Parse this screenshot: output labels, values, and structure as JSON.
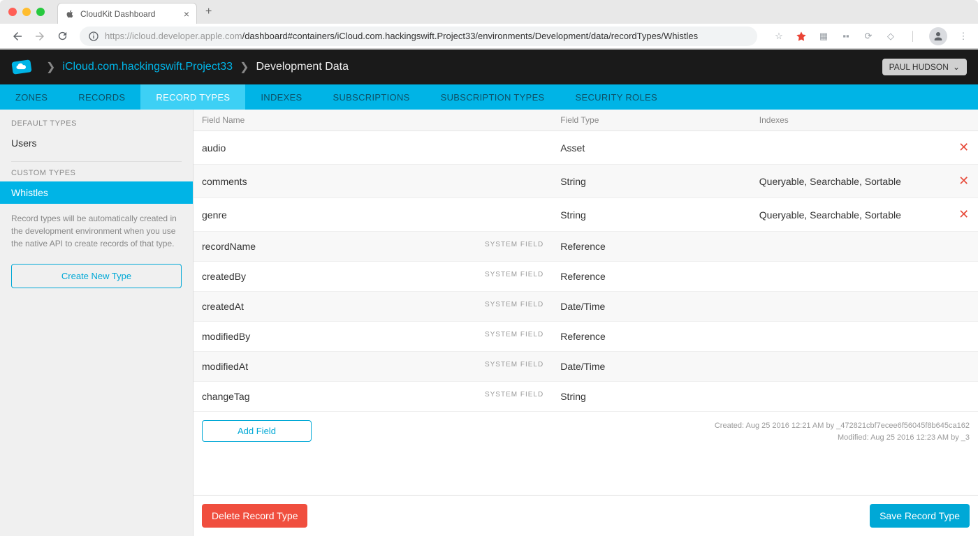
{
  "browser": {
    "tab_title": "CloudKit Dashboard",
    "url_host": "https://icloud.developer.apple.com",
    "url_path": "/dashboard#containers/iCloud.com.hackingswift.Project33/environments/Development/data/recordTypes/Whistles"
  },
  "header": {
    "breadcrumb_link": "iCloud.com.hackingswift.Project33",
    "breadcrumb_current": "Development Data",
    "user_name": "PAUL HUDSON"
  },
  "nav_tabs": [
    "ZONES",
    "RECORDS",
    "RECORD TYPES",
    "INDEXES",
    "SUBSCRIPTIONS",
    "SUBSCRIPTION TYPES",
    "SECURITY ROLES"
  ],
  "nav_tabs_active_index": 2,
  "sidebar": {
    "default_header": "DEFAULT TYPES",
    "default_items": [
      "Users"
    ],
    "custom_header": "CUSTOM TYPES",
    "custom_items": [
      "Whistles"
    ],
    "custom_selected_index": 0,
    "help_text": "Record types will be automatically created in the development environment when you use the native API to create records of that type.",
    "create_button": "Create New Type"
  },
  "table": {
    "columns": [
      "Field Name",
      "Field Type",
      "Indexes"
    ],
    "rows": [
      {
        "name": "audio",
        "type": "Asset",
        "indexes": "",
        "system": false,
        "deletable": true
      },
      {
        "name": "comments",
        "type": "String",
        "indexes": "Queryable, Searchable, Sortable",
        "system": false,
        "deletable": true
      },
      {
        "name": "genre",
        "type": "String",
        "indexes": "Queryable, Searchable, Sortable",
        "system": false,
        "deletable": true
      },
      {
        "name": "recordName",
        "type": "Reference",
        "indexes": "",
        "system": true,
        "deletable": false
      },
      {
        "name": "createdBy",
        "type": "Reference",
        "indexes": "",
        "system": true,
        "deletable": false
      },
      {
        "name": "createdAt",
        "type": "Date/Time",
        "indexes": "",
        "system": true,
        "deletable": false
      },
      {
        "name": "modifiedBy",
        "type": "Reference",
        "indexes": "",
        "system": true,
        "deletable": false
      },
      {
        "name": "modifiedAt",
        "type": "Date/Time",
        "indexes": "",
        "system": true,
        "deletable": false
      },
      {
        "name": "changeTag",
        "type": "String",
        "indexes": "",
        "system": true,
        "deletable": false
      }
    ],
    "system_label": "SYSTEM FIELD",
    "add_field_button": "Add Field",
    "meta": {
      "created": "Created:  Aug 25 2016 12:21 AM  by _472821cbf7ecee6f56045f8b645ca162",
      "modified": "Modified:  Aug 25 2016 12:23 AM  by _3"
    }
  },
  "footer": {
    "delete_button": "Delete Record Type",
    "save_button": "Save Record Type"
  }
}
